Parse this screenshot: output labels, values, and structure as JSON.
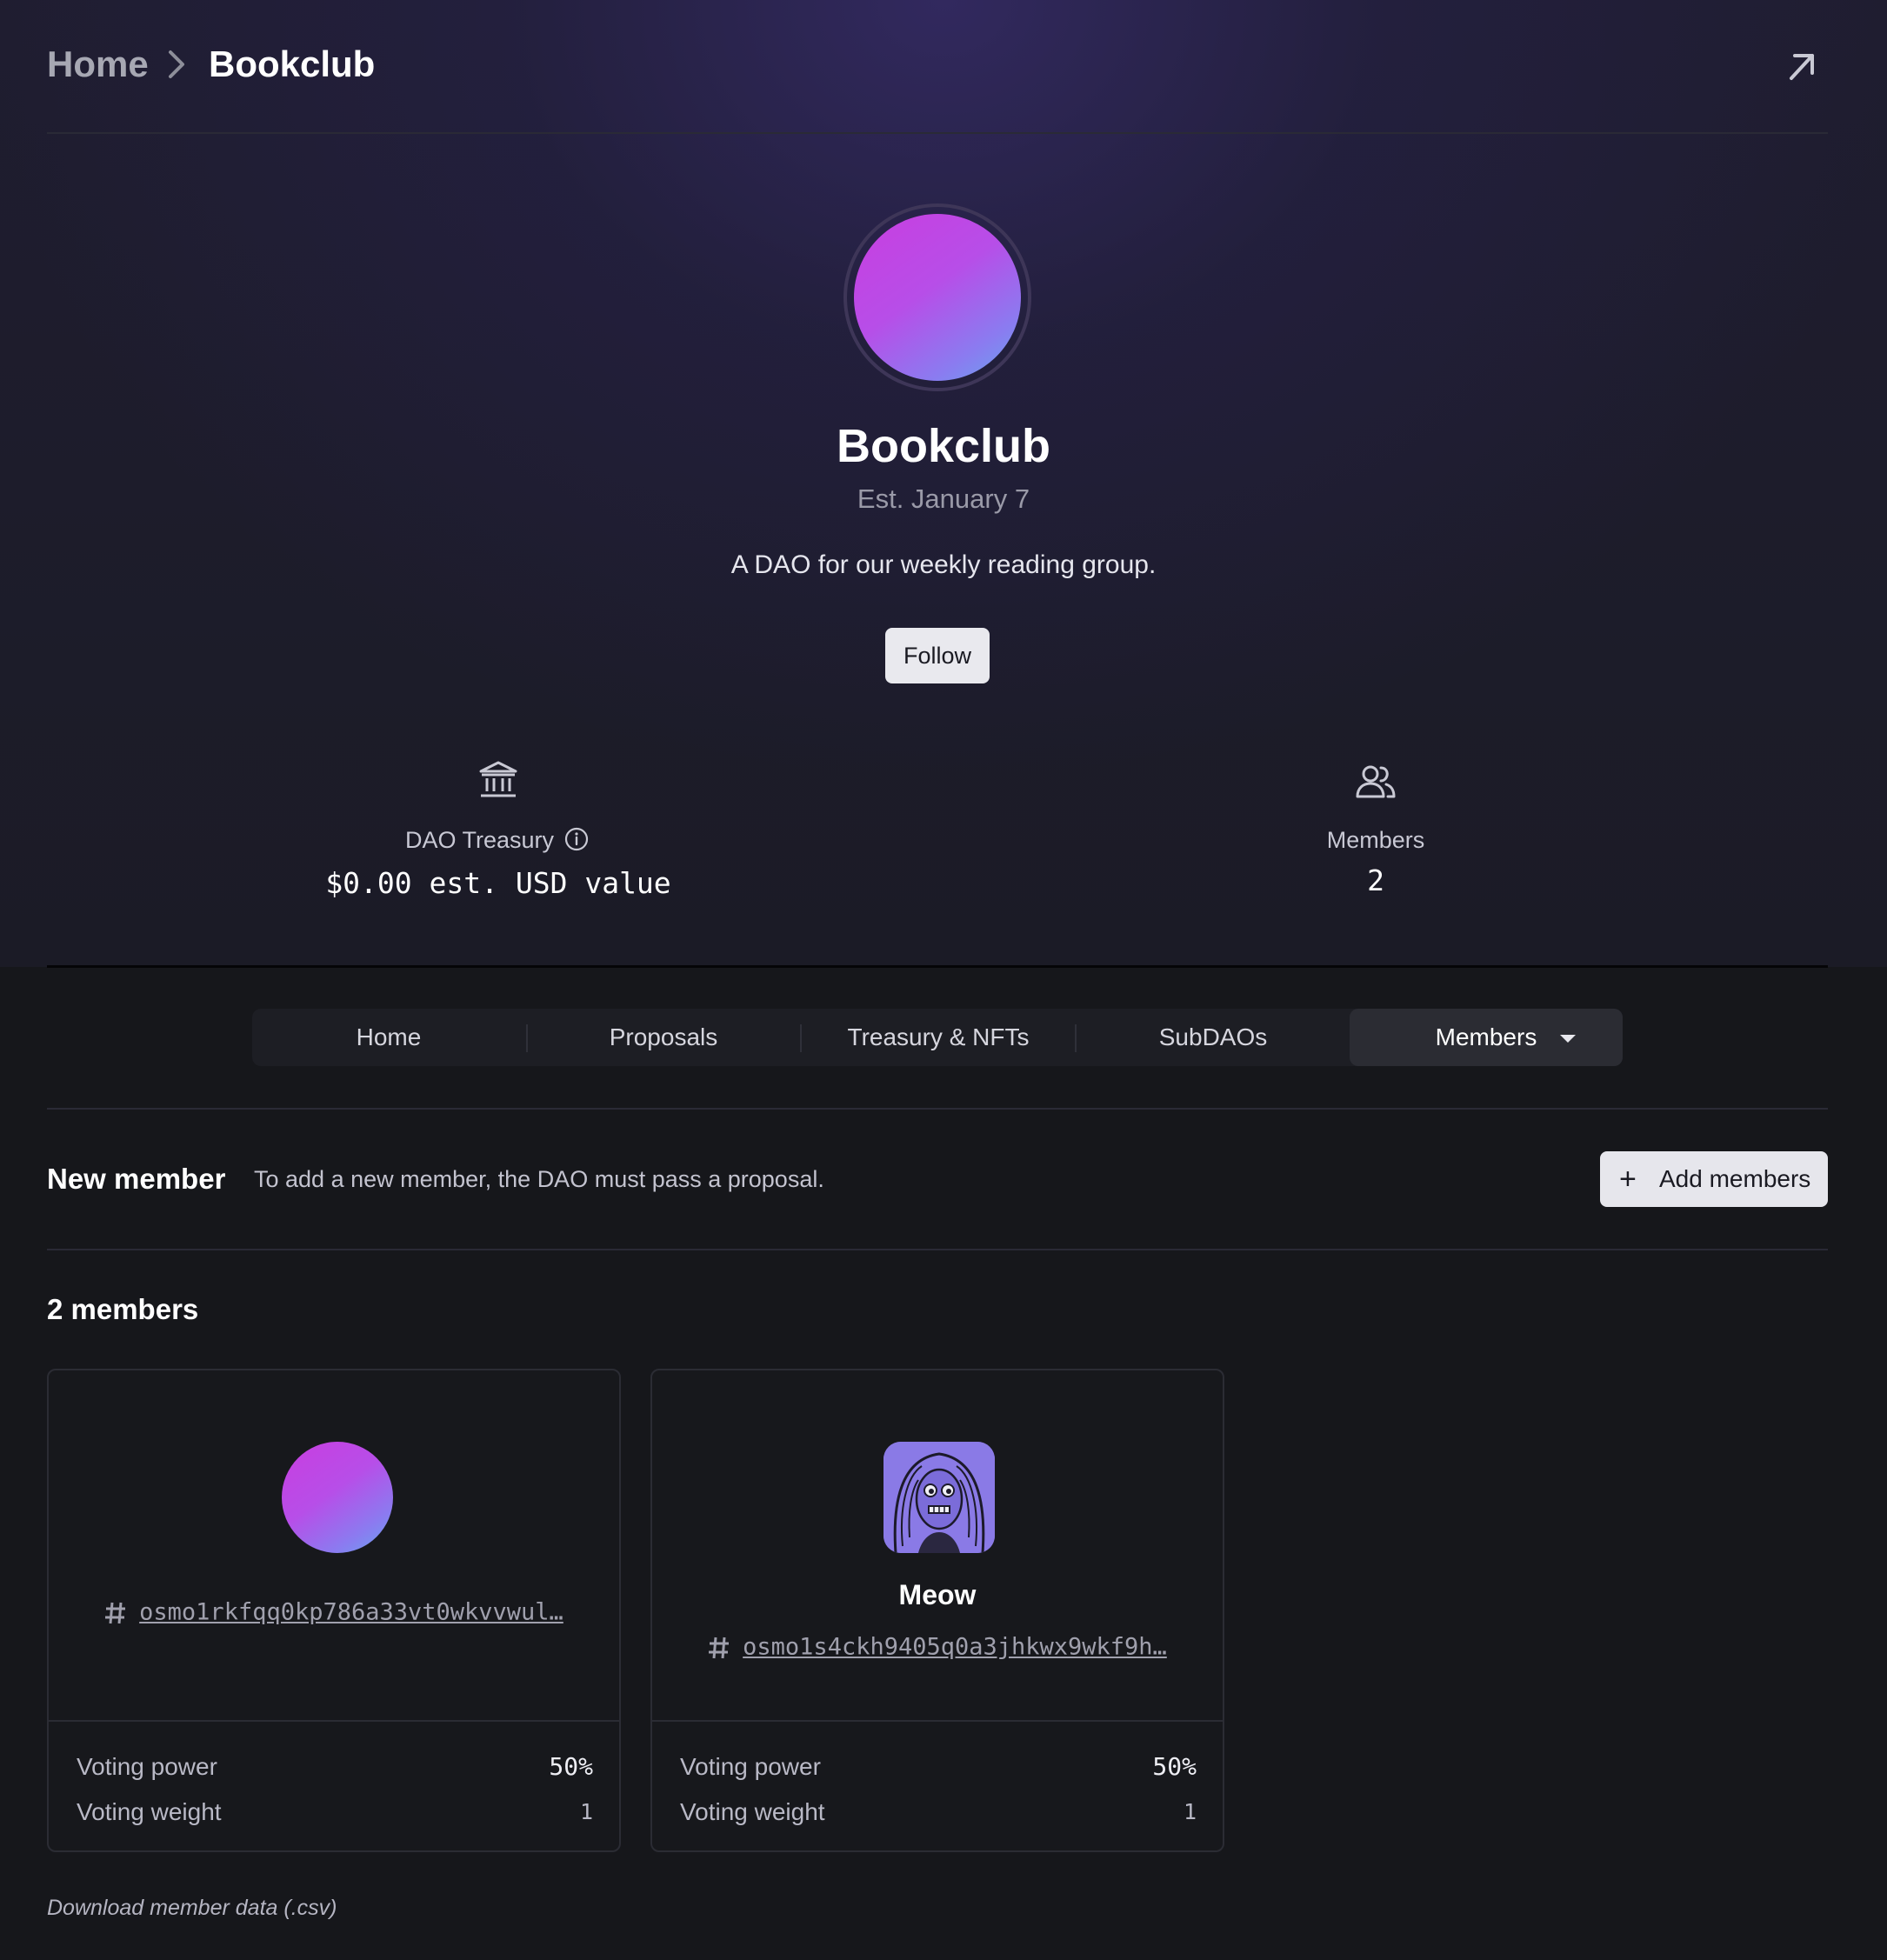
{
  "breadcrumb": {
    "home": "Home",
    "current": "Bookclub"
  },
  "dao": {
    "name": "Bookclub",
    "established": "Est. January 7",
    "description": "A DAO for our weekly reading group.",
    "follow_label": "Follow"
  },
  "stats": {
    "treasury_label": "DAO Treasury",
    "treasury_value": "$0.00 est. USD value",
    "members_label": "Members",
    "members_value": "2"
  },
  "tabs": [
    {
      "label": "Home"
    },
    {
      "label": "Proposals"
    },
    {
      "label": "Treasury & NFTs"
    },
    {
      "label": "SubDAOs"
    },
    {
      "label": "Members",
      "active": true
    }
  ],
  "new_member": {
    "title": "New member",
    "description": "To add a new member, the DAO must pass a proposal.",
    "add_label": "Add members"
  },
  "members_title": "2 members",
  "members": [
    {
      "name": "",
      "address": "osmo1rkfqq0kp786a33vt0wkvvwul…",
      "voting_power_label": "Voting power",
      "voting_power": "50%",
      "voting_weight_label": "Voting weight",
      "voting_weight": "1"
    },
    {
      "name": "Meow",
      "address": "osmo1s4ckh9405q0a3jhkwx9wkf9h…",
      "voting_power_label": "Voting power",
      "voting_power": "50%",
      "voting_weight_label": "Voting weight",
      "voting_weight": "1"
    }
  ],
  "download_label": "Download member data (.csv)",
  "colors": {
    "background": "#16171b",
    "avatar_gradient_start": "#c93ee0",
    "avatar_gradient_end": "#68a6ee",
    "button_bg": "#e9e9ee"
  },
  "icons": {
    "breadcrumb_separator": "chevron-right-icon",
    "open": "arrow-up-right-icon",
    "treasury": "bank-icon",
    "info": "info-icon",
    "members": "users-icon",
    "tab_dropdown": "caret-down-icon",
    "add": "plus-icon",
    "address": "hash-icon"
  }
}
